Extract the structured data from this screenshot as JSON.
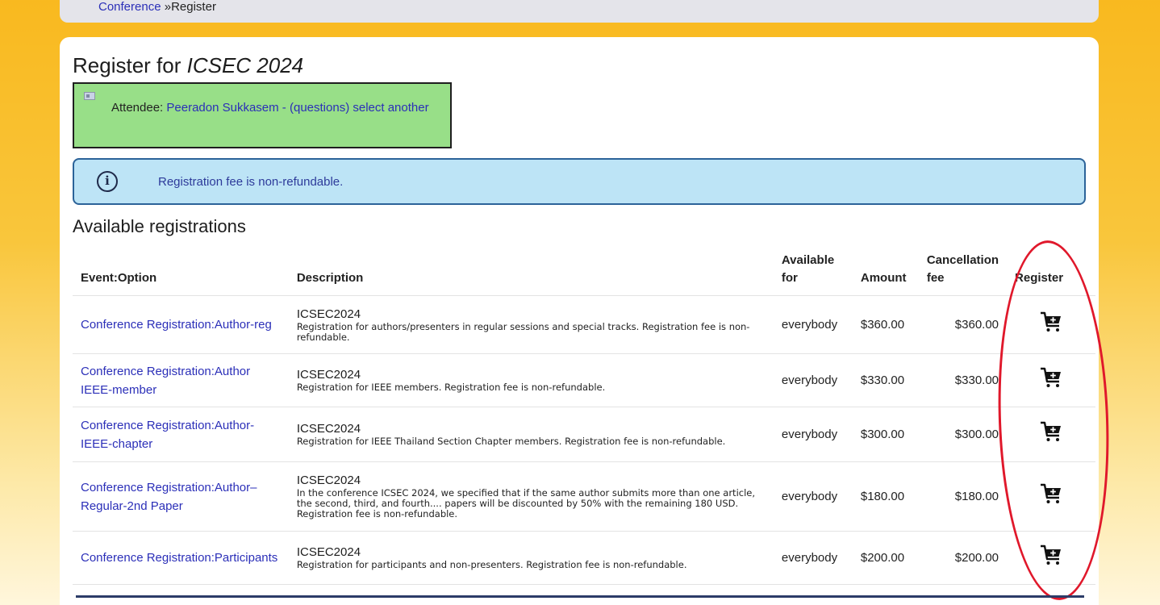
{
  "breadcrumb": {
    "link": "Conference",
    "separator": " »",
    "current": "Register"
  },
  "header": {
    "title_prefix": "Register for ",
    "title_event": "ICSEC 2024"
  },
  "attendee": {
    "label": "Attendee: ",
    "name": "Peeradon Sukkasem",
    "dash": " - ",
    "questions_link": "(questions)",
    "select_link": "select another"
  },
  "notice": {
    "text": "Registration fee is non-refundable."
  },
  "section": {
    "title": "Available registrations"
  },
  "table": {
    "headers": {
      "event_option": "Event:Option",
      "description": "Description",
      "available_for": "Available for",
      "amount": "Amount",
      "cancellation_fee": "Cancellation fee",
      "register": "Register"
    },
    "rows": [
      {
        "event": "Conference Registration:Author-reg",
        "desc_title": "ICSEC2024",
        "desc_text": "Registration for authors/presenters in regular sessions and special tracks. Registration fee is non-refundable.",
        "available_for": "everybody",
        "amount": "$360.00",
        "cancellation_fee": "$360.00"
      },
      {
        "event": "Conference Registration:Author IEEE-member",
        "desc_title": "ICSEC2024",
        "desc_text": "Registration for IEEE members. Registration fee is non-refundable.",
        "available_for": "everybody",
        "amount": "$330.00",
        "cancellation_fee": "$330.00"
      },
      {
        "event": "Conference Registration:Author-IEEE-chapter",
        "desc_title": "ICSEC2024",
        "desc_text": "Registration for IEEE Thailand Section Chapter members. Registration fee is non-refundable.",
        "available_for": "everybody",
        "amount": "$300.00",
        "cancellation_fee": "$300.00"
      },
      {
        "event": "Conference Registration:Author–Regular-2nd Paper",
        "desc_title": "ICSEC2024",
        "desc_text": "In the conference ICSEC 2024, we specified that if the same author submits more than one article, the second, third, and fourth.... papers will be discounted by 50% with the remaining 180 USD. Registration fee is non-refundable.",
        "available_for": "everybody",
        "amount": "$180.00",
        "cancellation_fee": "$180.00"
      },
      {
        "event": "Conference Registration:Participants",
        "desc_title": "ICSEC2024",
        "desc_text": "Registration for participants and non-presenters. Registration fee is non-refundable.",
        "available_for": "everybody",
        "amount": "$200.00",
        "cancellation_fee": "$200.00"
      }
    ]
  },
  "colors": {
    "accent_link": "#2b2fb8",
    "attendee_bg": "#98df88",
    "notice_bg": "#bde4f6",
    "annotation": "#e0182b"
  },
  "icons": {
    "cart": "add-to-cart-icon",
    "info": "info-icon",
    "attendee": "id-card-icon"
  }
}
